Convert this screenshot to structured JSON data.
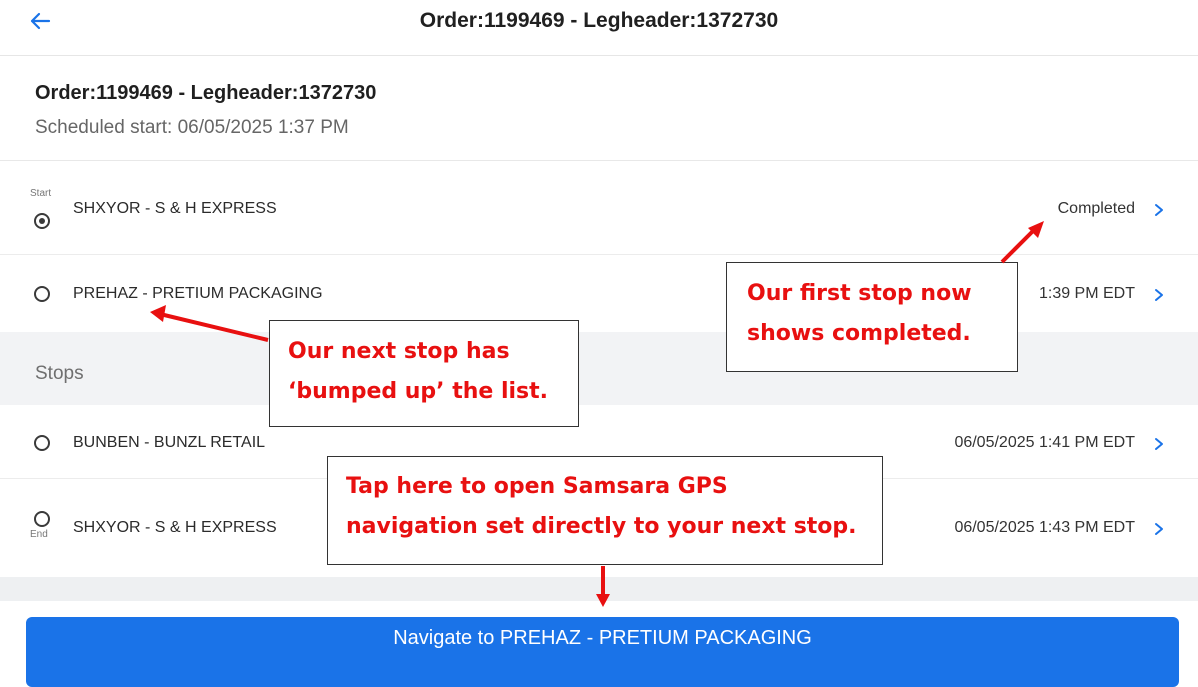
{
  "header": {
    "title": "Order:1199469 - Legheader:1372730",
    "back_icon": "arrow-left-icon"
  },
  "order": {
    "title": "Order:1199469 - Legheader:1372730",
    "scheduled": "Scheduled start: 06/05/2025 1:37 PM"
  },
  "start_stop": {
    "tag": "Start",
    "name": "SHXYOR - S & H EXPRESS",
    "status": "Completed",
    "selected": true
  },
  "next_stop": {
    "name": "PREHAZ - PRETIUM PACKAGING",
    "time_visible": "1:39 PM EDT"
  },
  "stops_section": {
    "title": "Stops"
  },
  "stops": [
    {
      "name": "BUNBEN - BUNZL RETAIL",
      "time": "06/05/2025 1:41 PM EDT"
    }
  ],
  "end_stop": {
    "tag": "End",
    "name": "SHXYOR - S & H EXPRESS",
    "time": "06/05/2025 1:43 PM EDT"
  },
  "navigate_button": {
    "label": "Navigate to PREHAZ - PRETIUM PACKAGING"
  },
  "annotations": {
    "next_stop": [
      "Our next stop has",
      "‘bumped up’ the list."
    ],
    "completed": [
      "Our first stop now",
      "shows completed."
    ],
    "navigate": [
      "Tap here to open Samsara GPS",
      "navigation set directly to your next stop."
    ]
  },
  "colors": {
    "accent": "#1a73e8",
    "annotation": "#e81010"
  }
}
